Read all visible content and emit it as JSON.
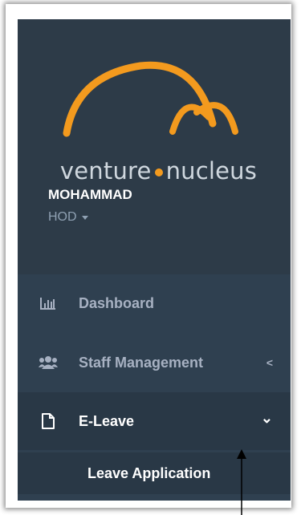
{
  "logo": {
    "text_left": "venture",
    "text_right": "nucleus",
    "accent_color": "#f39a1e"
  },
  "user": {
    "name": "MOHAMMAD",
    "role": "HOD"
  },
  "menu": {
    "items": [
      {
        "label": "Dashboard",
        "icon": "bar-chart-icon"
      },
      {
        "label": "Staff Management",
        "icon": "users-icon",
        "chevron": "<"
      },
      {
        "label": "E-Leave",
        "icon": "file-icon",
        "chevron": "⌄"
      }
    ],
    "subitems": [
      {
        "label": "Leave Application"
      }
    ]
  },
  "colors": {
    "sidebar_bg": "#2f4050",
    "active_bg": "#293846",
    "text_muted": "#a7b1c2"
  }
}
